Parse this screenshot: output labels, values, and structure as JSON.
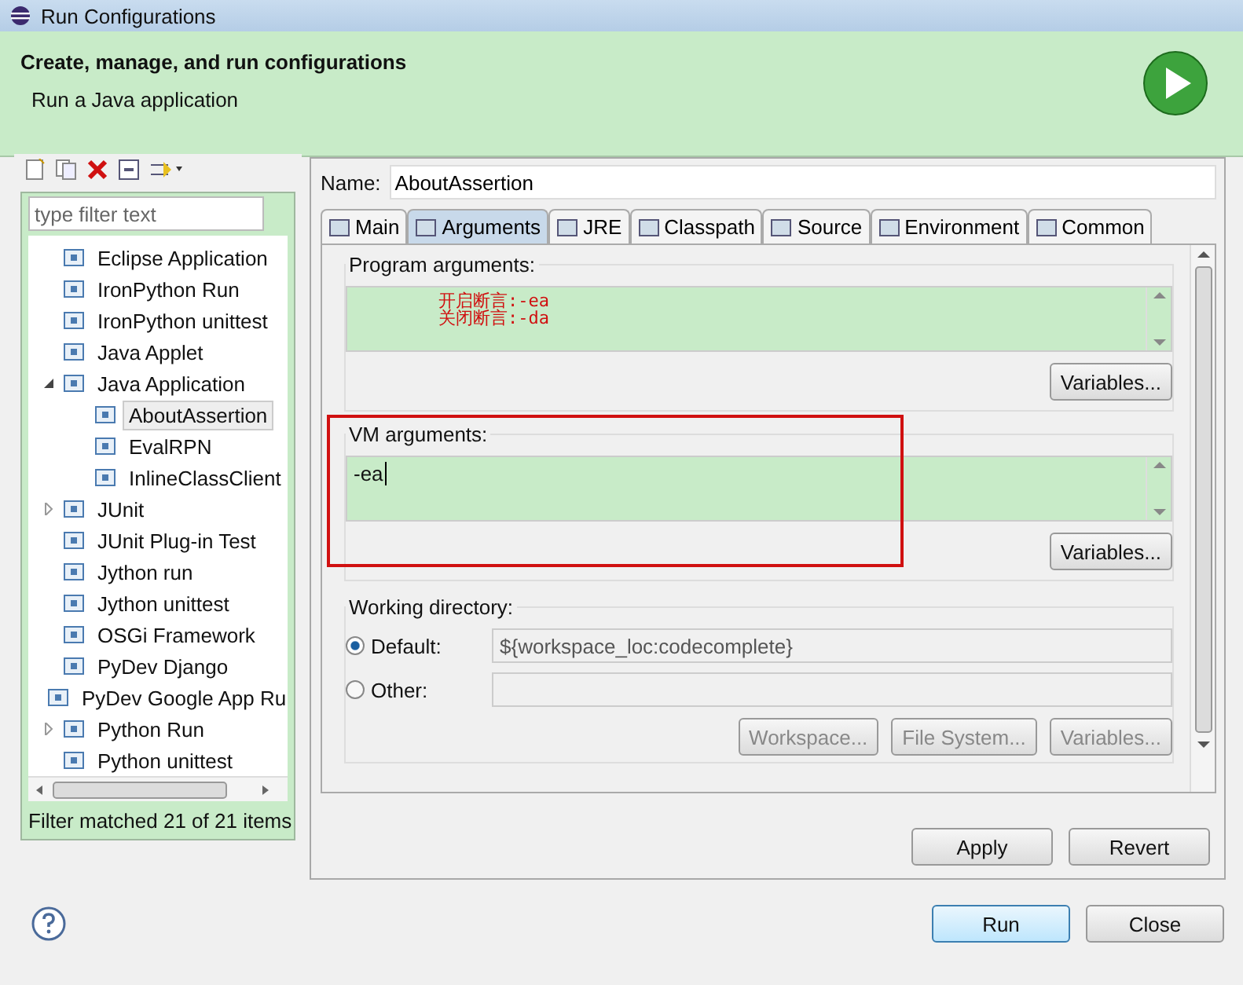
{
  "window": {
    "title": "Run Configurations"
  },
  "header": {
    "title": "Create, manage, and run configurations",
    "subtitle": "Run a Java application"
  },
  "sidebar": {
    "filter": {
      "placeholder": "type filter text"
    },
    "tree": [
      {
        "label": "Eclipse Application",
        "selected": false
      },
      {
        "label": "IronPython Run",
        "selected": false
      },
      {
        "label": "IronPython unittest",
        "selected": false
      },
      {
        "label": "Java Applet",
        "selected": false
      },
      {
        "label": "Java Application",
        "selected": false,
        "expanded": true,
        "children": [
          {
            "label": "AboutAssertion",
            "selected": true
          },
          {
            "label": "EvalRPN",
            "selected": false
          },
          {
            "label": "InlineClassClient",
            "selected": false
          }
        ]
      },
      {
        "label": "JUnit",
        "selected": false,
        "expanded": false
      },
      {
        "label": "JUnit Plug-in Test",
        "selected": false
      },
      {
        "label": "Jython run",
        "selected": false
      },
      {
        "label": "Jython unittest",
        "selected": false
      },
      {
        "label": "OSGi Framework",
        "selected": false
      },
      {
        "label": "PyDev Django",
        "selected": false
      },
      {
        "label": "PyDev Google App Ru",
        "selected": false
      },
      {
        "label": "Python Run",
        "selected": false,
        "expanded": false
      },
      {
        "label": "Python unittest",
        "selected": false
      }
    ],
    "status": "Filter matched 21 of 21 items"
  },
  "name": {
    "label": "Name:",
    "value": "AboutAssertion"
  },
  "tabs": [
    {
      "label": "Main",
      "selected": false
    },
    {
      "label": "Arguments",
      "selected": true
    },
    {
      "label": "JRE",
      "selected": false
    },
    {
      "label": "Classpath",
      "selected": false
    },
    {
      "label": "Source",
      "selected": false
    },
    {
      "label": "Environment",
      "selected": false
    },
    {
      "label": "Common",
      "selected": false
    }
  ],
  "program_arguments": {
    "label": "Program arguments:",
    "lines": [
      "开启断言:-ea",
      "关闭断言:-da"
    ],
    "button": "Variables..."
  },
  "vm_arguments": {
    "label": "VM arguments:",
    "value": "-ea",
    "button": "Variables..."
  },
  "working_directory": {
    "label": "Working directory:",
    "options": [
      {
        "label": "Default:",
        "selected": true,
        "value": "${workspace_loc:codecomplete}"
      },
      {
        "label": "Other:",
        "selected": false
      }
    ],
    "buttons": [
      {
        "label": "Workspace...",
        "disabled": true
      },
      {
        "label": "File System...",
        "disabled": true
      },
      {
        "label": "Variables...",
        "disabled": true
      }
    ]
  },
  "actions": [
    "Apply",
    "Revert"
  ],
  "footer": {
    "buttons": [
      {
        "label": "Run",
        "default": true
      },
      {
        "label": "Close",
        "default": false
      }
    ]
  }
}
